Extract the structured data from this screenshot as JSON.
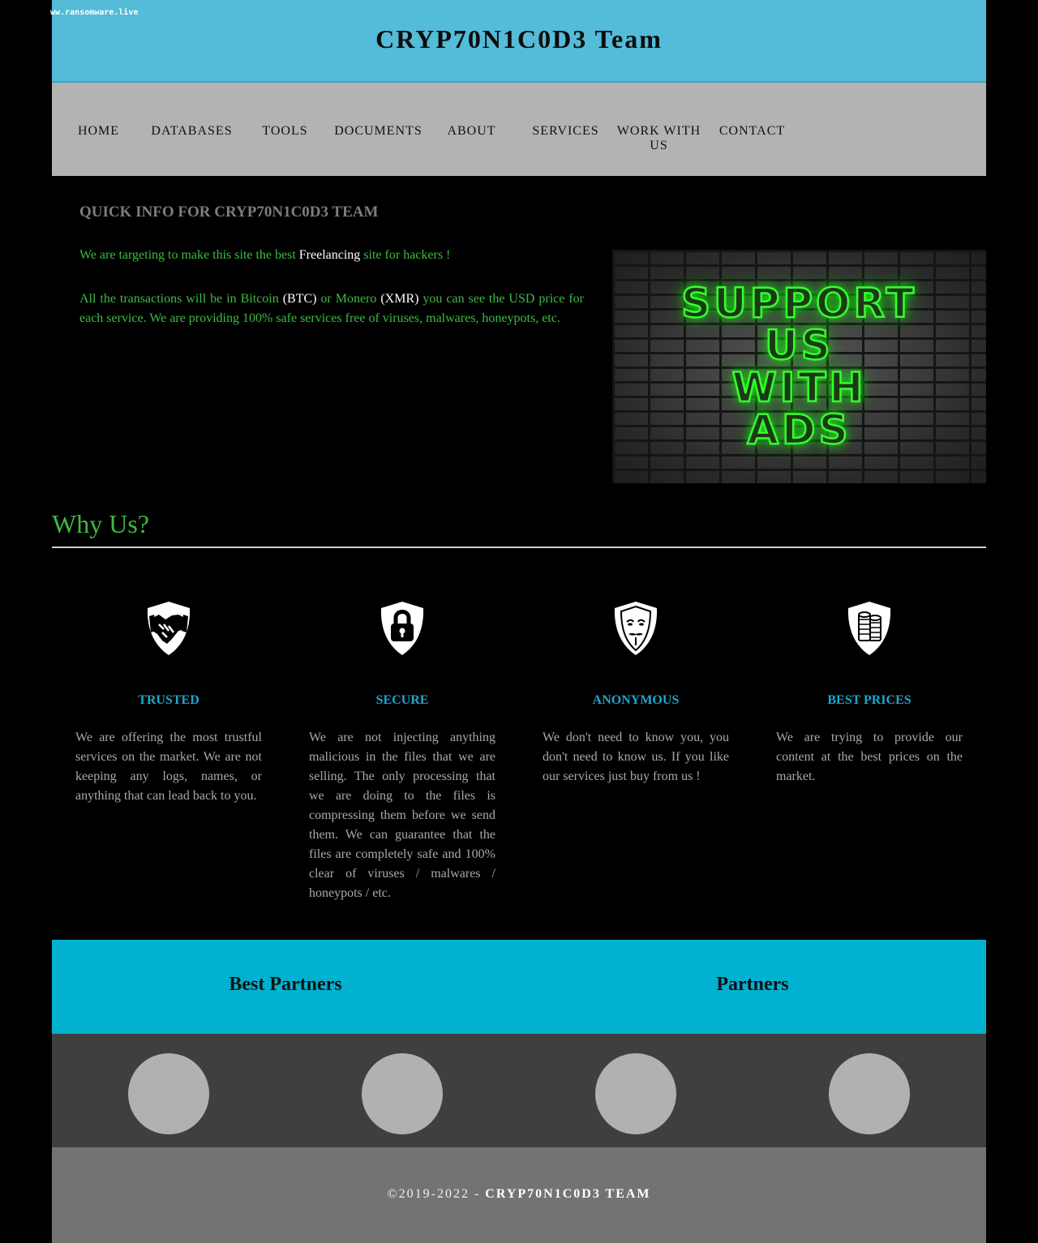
{
  "watermark": "ww.ransomware.live",
  "header": {
    "title": "CRYP70N1C0D3 Team"
  },
  "nav": {
    "items": [
      "HOME",
      "DATABASES",
      "TOOLS",
      "DOCUMENTS",
      "ABOUT",
      "SERVICES",
      "WORK WITH US",
      "CONTACT"
    ]
  },
  "quick_info": {
    "title": "QUICK INFO FOR CRYP70N1C0D3 TEAM",
    "p1": {
      "a": "We are targeting to make this site the best ",
      "b": "Freelancing",
      "c": " site for hackers !"
    },
    "p2": {
      "a": "All the transactions will be in Bitcoin ",
      "b": "(BTC)",
      "c": " or Monero ",
      "d": "(XMR)",
      "e": " you can see the USD price for each service. We are providing 100% safe services free of viruses, malwares, honeypots, etc."
    },
    "ad": {
      "line1": "SUPPORT",
      "line2": "US",
      "line3": "WITH",
      "line4": "ADS"
    }
  },
  "why_us": {
    "title": "Why Us?",
    "features": [
      {
        "icon": "handshake-shield-icon",
        "title": "TRUSTED",
        "text": "We are offering the most trustful services on the market. We are not keeping any logs, names, or anything that can lead back to you."
      },
      {
        "icon": "padlock-shield-icon",
        "title": "SECURE",
        "text": "We are not injecting anything malicious in the files that we are selling. The only processing that we are doing to the files is compressing them before we send them. We can guarantee that the files are completely safe and 100% clear of viruses / malwares / honeypots / etc."
      },
      {
        "icon": "mask-shield-icon",
        "title": "ANONYMOUS",
        "text": "We don't need to know you, you don't need to know us. If you like our services just buy from us !"
      },
      {
        "icon": "coins-shield-icon",
        "title": "BEST PRICES",
        "text": "We are trying to provide our content at the best prices on the market."
      }
    ]
  },
  "partners": {
    "best": "Best Partners",
    "other": "Partners"
  },
  "footer": {
    "copyright": "©2019-2022 - ",
    "brand": "CRYP70N1C0D3 TEAM"
  },
  "colors": {
    "header_bg": "#54bbd8",
    "nav_bg": "#b3b3b3",
    "green_text": "#3dbb43",
    "feature_title": "#1aa7cf",
    "partners_bar": "#00b1d0",
    "logos_band": "#3f3f3f",
    "footer_bg": "#737373"
  }
}
